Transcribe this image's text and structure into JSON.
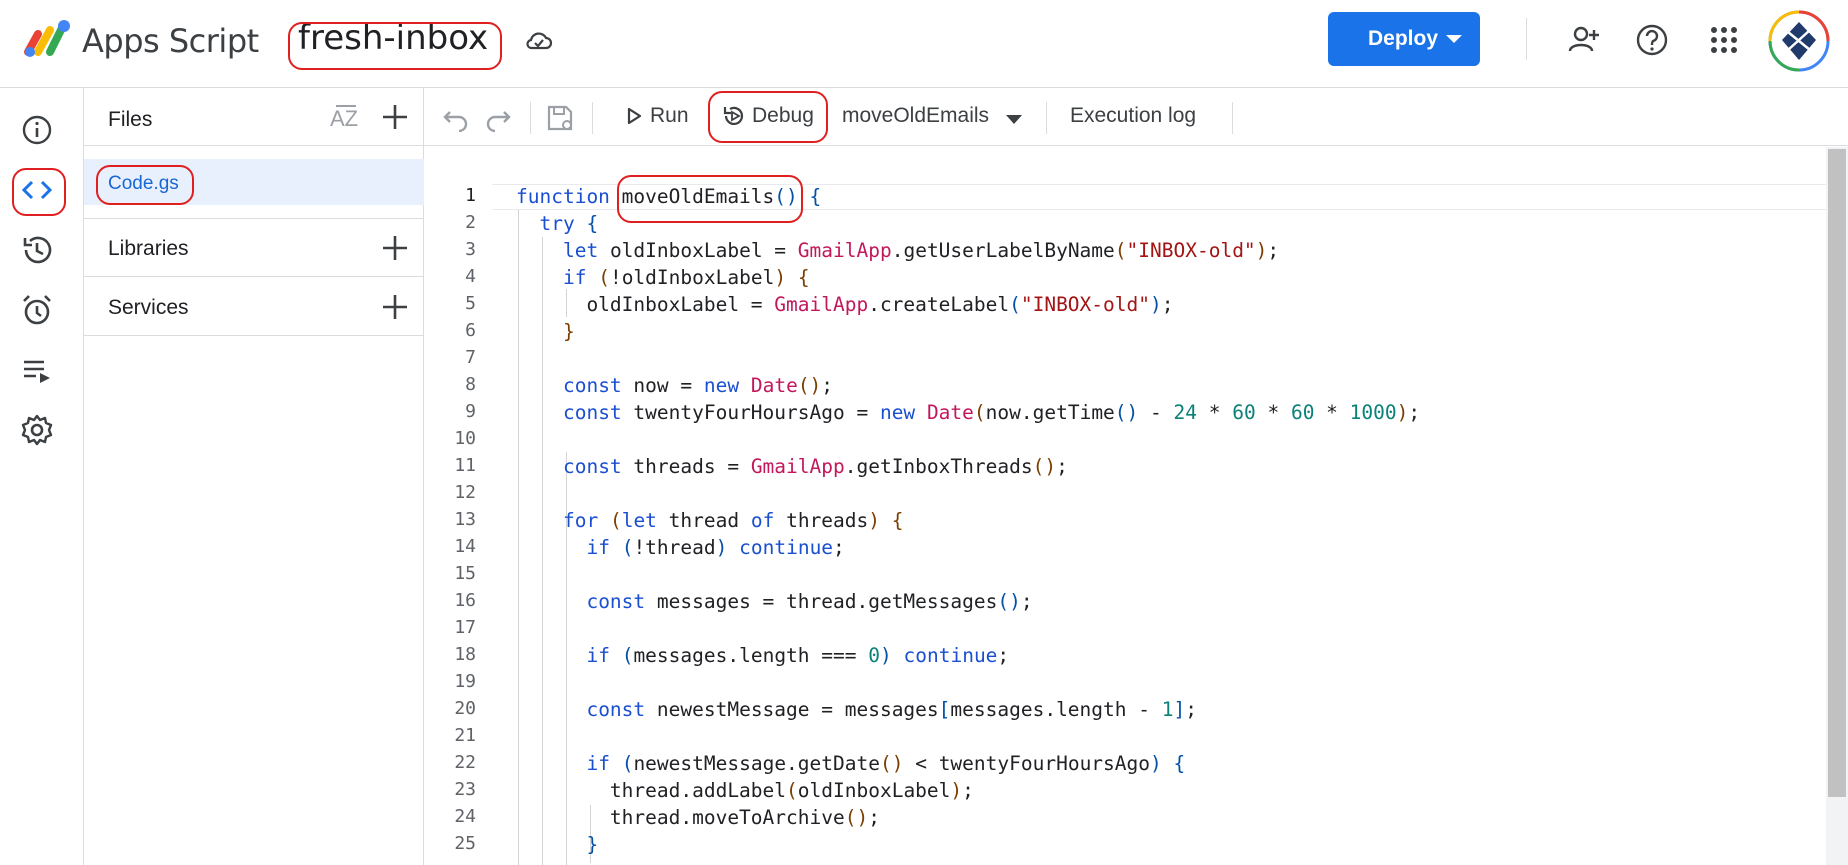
{
  "header": {
    "app_name": "Apps Script",
    "project_title": "fresh-inbox",
    "deploy_label": "Deploy"
  },
  "files_panel": {
    "title": "Files",
    "file": "Code.gs",
    "libraries": "Libraries",
    "services": "Services"
  },
  "toolbar": {
    "run": "Run",
    "debug": "Debug",
    "function_select": "moveOldEmails",
    "execution_log": "Execution log"
  },
  "editor": {
    "line_numbers": [
      "1",
      "2",
      "3",
      "4",
      "5",
      "6",
      "7",
      "8",
      "9",
      "10",
      "11",
      "12",
      "13",
      "14",
      "15",
      "16",
      "17",
      "18",
      "19",
      "20",
      "21",
      "22",
      "23",
      "24",
      "25"
    ],
    "lines": [
      "function moveOldEmails() {",
      "  try {",
      "    let oldInboxLabel = GmailApp.getUserLabelByName(\"INBOX-old\");",
      "    if (!oldInboxLabel) {",
      "      oldInboxLabel = GmailApp.createLabel(\"INBOX-old\");",
      "    }",
      "",
      "    const now = new Date();",
      "    const twentyFourHoursAgo = new Date(now.getTime() - 24 * 60 * 60 * 1000);",
      "",
      "    const threads = GmailApp.getInboxThreads();",
      "",
      "    for (let thread of threads) {",
      "      if (!thread) continue;",
      "",
      "      const messages = thread.getMessages();",
      "",
      "      if (messages.length === 0) continue;",
      "",
      "      const newestMessage = messages[messages.length - 1];",
      "",
      "      if (newestMessage.getDate() < twentyFourHoursAgo) {",
      "        thread.addLabel(oldInboxLabel);",
      "        thread.moveToArchive();",
      "      }"
    ]
  },
  "colors": {
    "accent": "#1a73e8",
    "keyword": "#1a4fd1",
    "class_name": "#c2185b",
    "string": "#a31515",
    "number": "#0b8178",
    "annotation": "#e02020"
  }
}
